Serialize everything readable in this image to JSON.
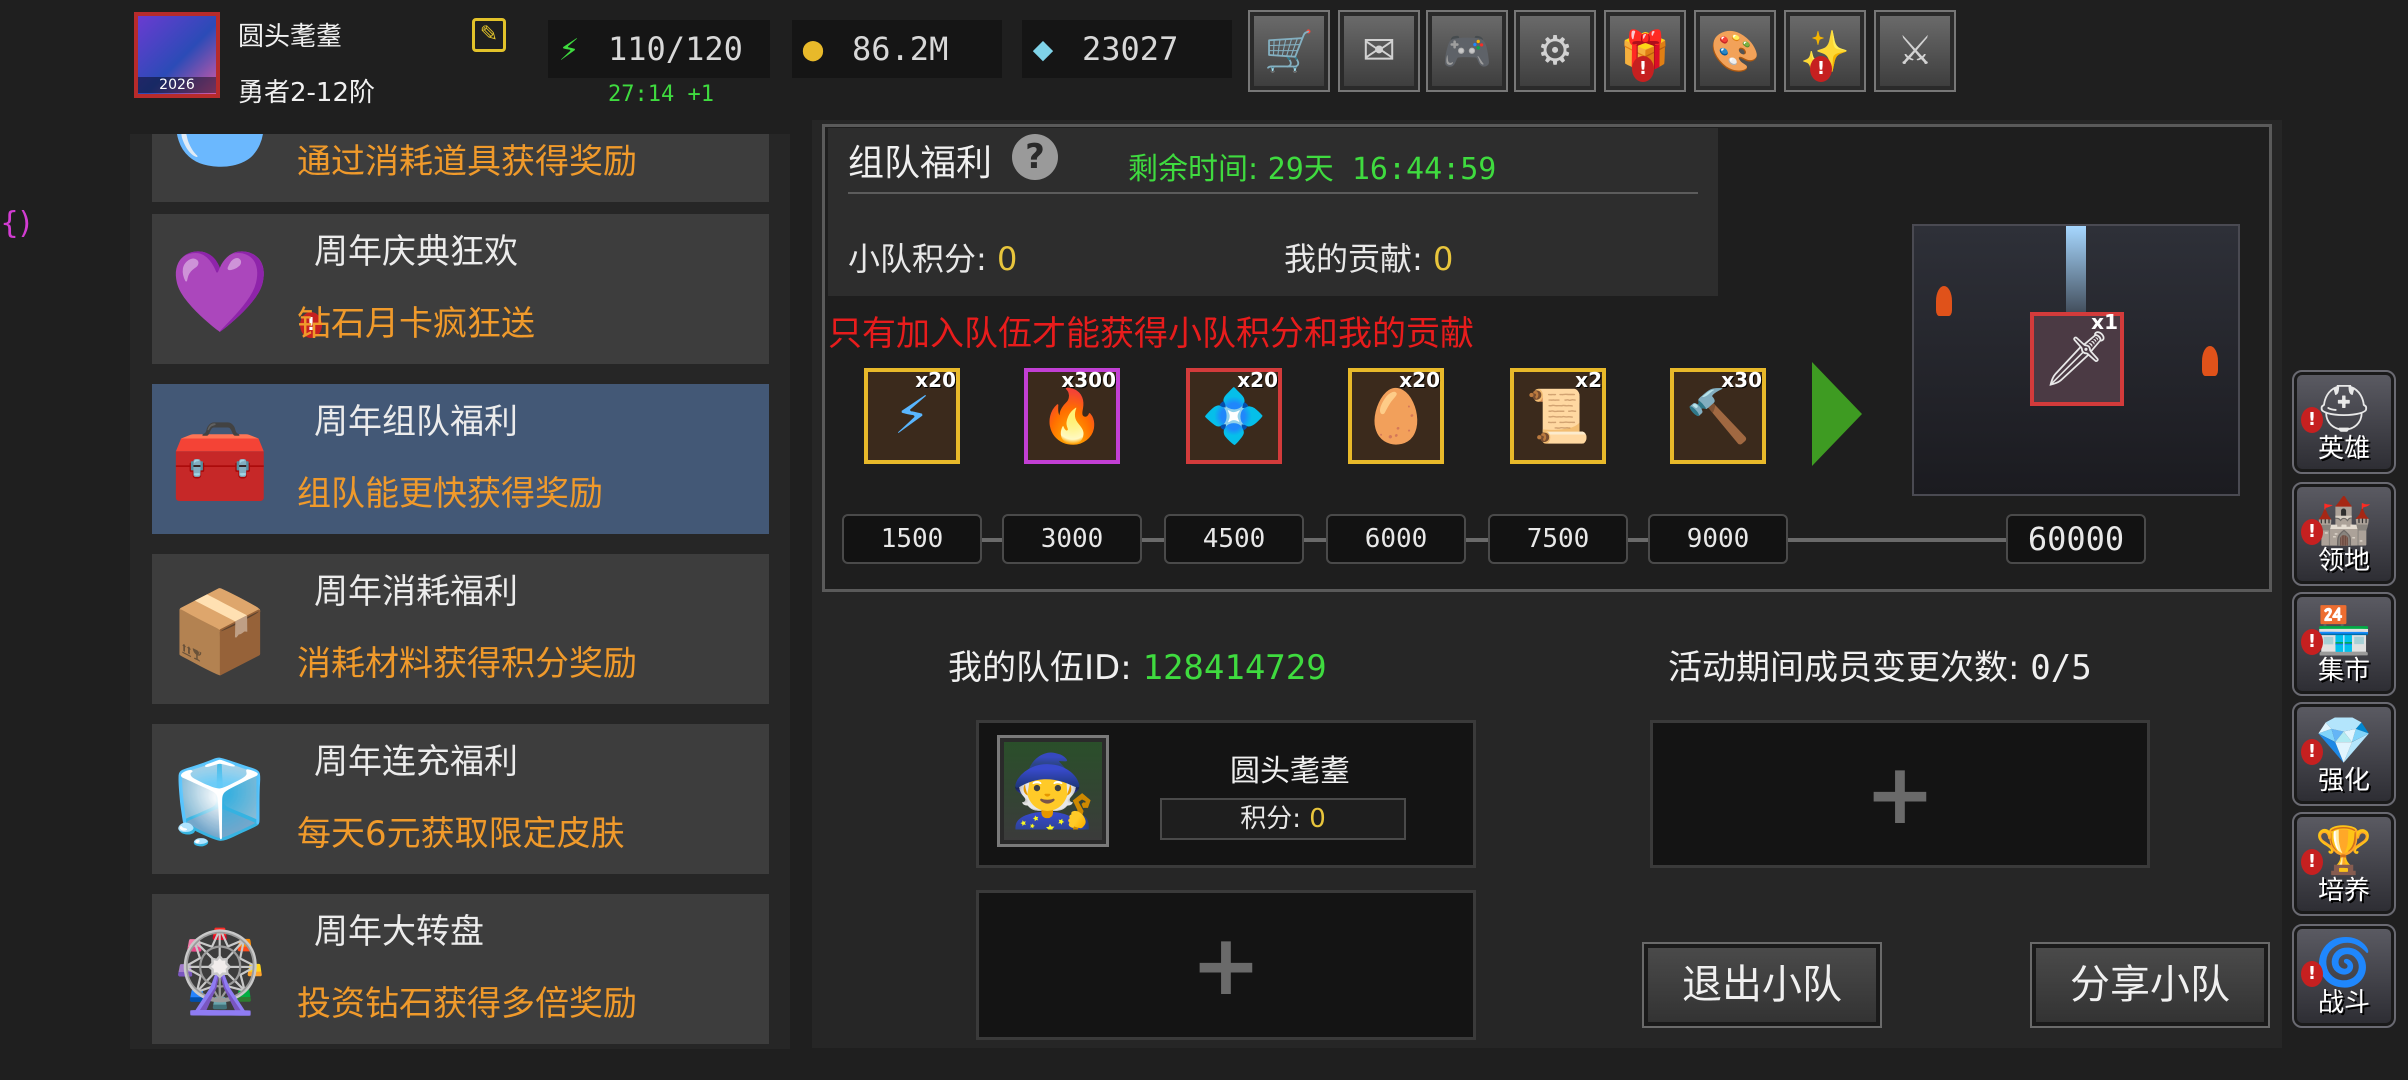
{
  "player": {
    "name": "圆头耄耋",
    "rank": "勇者2-12阶",
    "avatar_year": "2026"
  },
  "resources": {
    "energy": "110/120",
    "energy_timer": "27:14 +1",
    "gold": "86.2M",
    "diamonds": "23027"
  },
  "top_buttons": [
    "cart-icon",
    "mail-icon",
    "gamepad-icon",
    "gear-icon",
    "gift-icon",
    "color-wheel-icon",
    "fireworks-icon",
    "crossed-swords-icon"
  ],
  "events": [
    {
      "title": "",
      "subtitle": "通过消耗道具获得奖励",
      "icon": "bowl-icon"
    },
    {
      "title": "周年庆典狂欢",
      "subtitle": "钻石月卡疯狂送",
      "icon": "diamond-card-icon"
    },
    {
      "title": "周年组队福利",
      "subtitle": "组队能更快获得奖励",
      "icon": "treasure-chest-icon"
    },
    {
      "title": "周年消耗福利",
      "subtitle": "消耗材料获得积分奖励",
      "icon": "open-chest-icon"
    },
    {
      "title": "周年连充福利",
      "subtitle": "每天6元获取限定皮肤",
      "icon": "crystal-chest-icon"
    },
    {
      "title": "周年大转盘",
      "subtitle": "投资钻石获得多倍奖励",
      "icon": "wheel-icon"
    }
  ],
  "team_benefit": {
    "title": "组队福利",
    "remaining_label": "剩余时间:",
    "remaining_value": "29天 16:44:59",
    "team_score_label": "小队积分:",
    "team_score_value": "0",
    "my_contrib_label": "我的贡献:",
    "my_contrib_value": "0",
    "warning": "只有加入队伍才能获得小队积分和我的贡献"
  },
  "rewards": [
    {
      "icon": "lightning-icon",
      "glyph": "⚡",
      "qty": "x20",
      "frame": "gold"
    },
    {
      "icon": "flame-orb-icon",
      "glyph": "🔥",
      "qty": "x300",
      "frame": "purple"
    },
    {
      "icon": "blue-rune-icon",
      "glyph": "💠",
      "qty": "x20",
      "frame": "red"
    },
    {
      "icon": "golden-egg-icon",
      "glyph": "🥚",
      "qty": "x20",
      "frame": "gold"
    },
    {
      "icon": "scroll-icon",
      "glyph": "📜",
      "qty": "x2",
      "frame": "gold"
    },
    {
      "icon": "hammer-icon",
      "glyph": "🔨",
      "qty": "x30",
      "frame": "gold"
    }
  ],
  "grand_reward": {
    "qty": "x1",
    "icon": "skin-sprite-icon"
  },
  "milestones": [
    "1500",
    "3000",
    "4500",
    "6000",
    "7500",
    "9000"
  ],
  "final_milestone": "60000",
  "team": {
    "id_label": "我的队伍ID:",
    "id_value": "128414729",
    "change_label": "活动期间成员变更次数:",
    "change_value": "0/5",
    "member_name": "圆头耄耋",
    "member_score_label": "积分:",
    "member_score_value": "0",
    "leave_label": "退出小队",
    "share_label": "分享小队"
  },
  "right_nav": [
    {
      "label": "英雄",
      "icon": "helmet-icon",
      "glyph": "⛑"
    },
    {
      "label": "领地",
      "icon": "castle-icon",
      "glyph": "🏰"
    },
    {
      "label": "集市",
      "icon": "market-icon",
      "glyph": "🏪"
    },
    {
      "label": "强化",
      "icon": "enhance-icon",
      "glyph": "💎"
    },
    {
      "label": "培养",
      "icon": "chalice-icon",
      "glyph": "🏆"
    },
    {
      "label": "战斗",
      "icon": "portal-icon",
      "glyph": "🌀"
    }
  ],
  "colors": {
    "accent_orange": "#f09a2b",
    "green_text": "#3fdb3f",
    "warning_red": "#e81c1c",
    "score_yellow": "#e8c53c",
    "active_card": "#435876"
  }
}
